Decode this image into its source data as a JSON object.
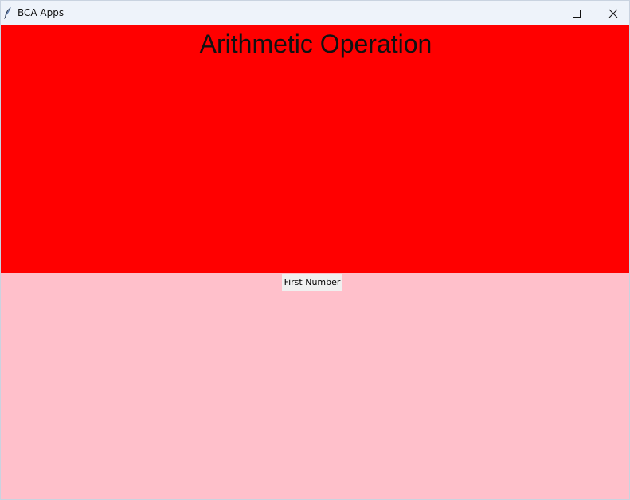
{
  "window": {
    "title": "BCA Apps",
    "icon": "feather-icon",
    "controls": {
      "minimize": "minimize-icon",
      "maximize": "maximize-icon",
      "close": "close-icon"
    }
  },
  "top_frame": {
    "heading": "Arithmetic Operation",
    "background": "#ff0000"
  },
  "bottom_frame": {
    "first_number_label": "First Number",
    "background": "#ffc0cb"
  }
}
